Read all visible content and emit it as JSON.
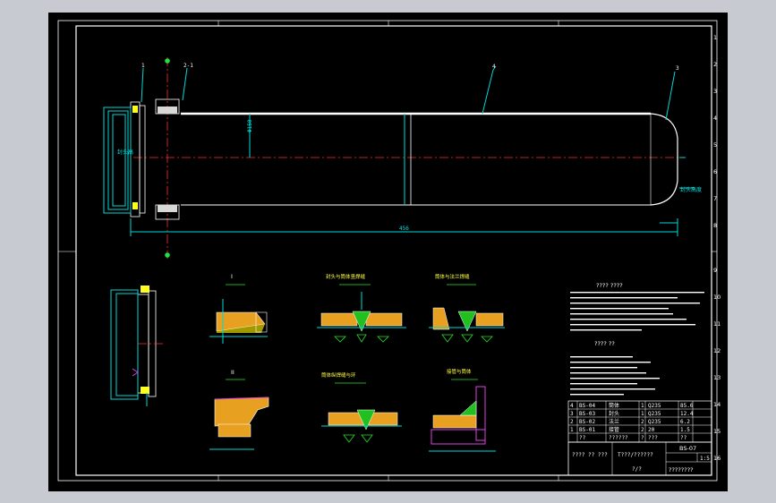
{
  "drawing": {
    "part_labels": [
      "1",
      "2",
      "3",
      "4",
      "2-1"
    ],
    "detail_titles": [
      "封头与筒体竖焊缝",
      "筒体与法兰焊缝",
      "筒体纵焊缝与环",
      "接管与筒体"
    ],
    "detail_subtitles": [
      "I",
      "I",
      "II",
      "II"
    ],
    "tech_req_title": "????  ????",
    "note_title": "???? ??",
    "title_left": "???? ?? ???",
    "title_mid": "T???/??????",
    "drawing_no": "?/?",
    "drawing_code": "BS-07",
    "scale": "1:5",
    "title_name": "????????",
    "bom_rows": [
      [
        "4",
        "BS-04",
        "筒体",
        "1",
        "Q235",
        "85.6"
      ],
      [
        "3",
        "BS-03",
        "封头",
        "1",
        "Q235",
        "12.4"
      ],
      [
        "2",
        "BS-02",
        "法兰",
        "2",
        "Q235",
        "6.2"
      ],
      [
        "1",
        "BS-01",
        "接管",
        "2",
        "20",
        "1.5"
      ],
      [
        "",
        "??",
        "??????",
        "?",
        "???",
        "??"
      ]
    ],
    "dims": {
      "overall_length": "456",
      "shell_id": "Φ150",
      "ring": "封头高",
      "right_note": "封头高度"
    }
  }
}
